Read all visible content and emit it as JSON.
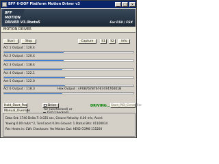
{
  "window": {
    "title": "BFF 6-DOF Platform Motion Driver v3",
    "buttons": {
      "minimize": "_",
      "maximize": "□",
      "close": "×"
    }
  },
  "header": {
    "logo_line1": "BFF",
    "logo_line2": "MOTION",
    "logo_line3": "DRIVER V3.0beta5",
    "tagline": "For FS9 / FSX"
  },
  "section": {
    "title": "MOTION DRIVER"
  },
  "toolbar": {
    "start": "Start",
    "stop": "Stop",
    "capture": "Capture",
    "s1": "S1",
    "s2": "S2",
    "info": "Info"
  },
  "actuators": [
    {
      "label": "Act 1 Output : 120.4",
      "level": 0.46
    },
    {
      "label": "Act 2 Output : 120.4",
      "level": 0.46
    },
    {
      "label": "Act 3 Output : 118.4",
      "level": 0.45
    },
    {
      "label": "Act 4 Output : 122.1",
      "level": 0.47
    },
    {
      "label": "Act 5 Output : 122.0",
      "level": 0.47
    },
    {
      "label": "Act 6 Output : 118.3",
      "level": 0.45
    }
  ],
  "hex_output": "Hex Output : (#0876787676747476001B",
  "controls": {
    "hold_start_pos": "Hold_Start_Pos",
    "manual_override": "Manual_Override",
    "drive": "Drive",
    "air_unchecked": "Air (unchecked) or",
    "dof_checked": "Dof (checked)",
    "driving": "DRIVING...",
    "start_pid": "Start_PID_Controller"
  },
  "status": {
    "line1": "Data Set: 1740  Delta T: 0.025 sec,  Ground Velocity: 0.00 m/s,  Accel:",
    "line2": "Yawing 0.00 rad/s^2,  TurnCoord 0.0m Ground: 1  Status Bits: 01100014",
    "line3": "Rec Hexes in: CWs  Checksum: Yes  Motion Out: HEX2 COM8 115200"
  }
}
